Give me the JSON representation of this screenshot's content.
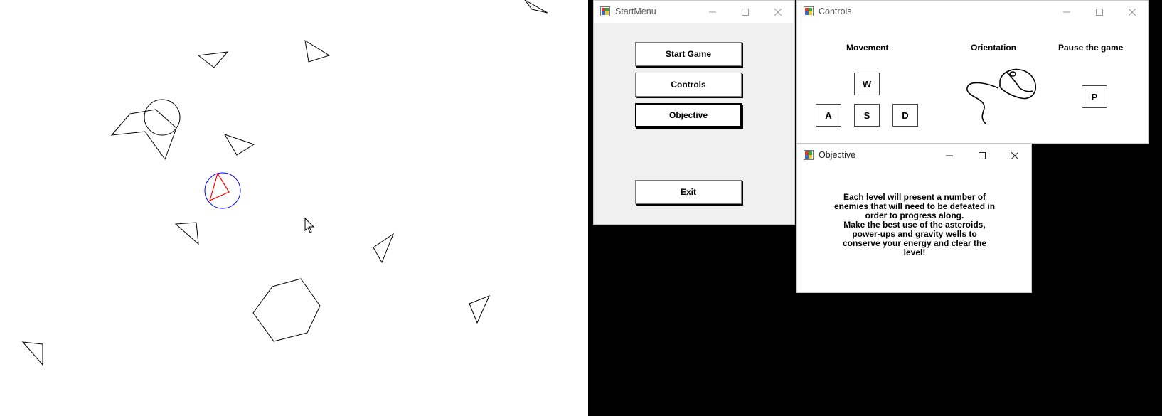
{
  "startmenu": {
    "title": "StartMenu",
    "buttons": {
      "start_game": "Start Game",
      "controls": "Controls",
      "objective": "Objective",
      "exit": "Exit"
    }
  },
  "controls_window": {
    "title": "Controls",
    "movement_label": "Movement",
    "orientation_label": "Orientation",
    "pause_label": "Pause the game",
    "keys": {
      "up": "W",
      "left": "A",
      "down": "S",
      "right": "D",
      "pause": "P"
    },
    "orientation_icon": "mouse-icon"
  },
  "objective_window": {
    "title": "Objective",
    "paragraph1": "Each level will present a number of enemies that will need to be defeated in order to progress along.",
    "paragraph2": "Make the best use of the asteroids, power-ups and gravity wells to conserve your energy and clear the level!"
  },
  "game": {
    "player_ship_color": "#ff0000",
    "player_shield_color": "#0000ff",
    "asteroid_color": "#000000"
  }
}
